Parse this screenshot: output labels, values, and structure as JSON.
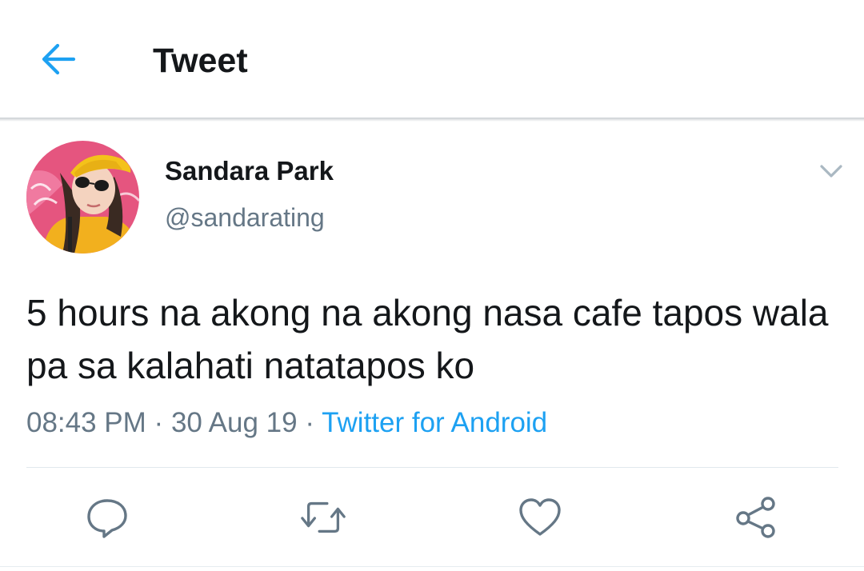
{
  "header": {
    "title": "Tweet",
    "back_icon": "arrow-left-icon",
    "accent_color": "#1da1f2"
  },
  "tweet": {
    "author": {
      "display_name": "Sandara Park",
      "handle": "@sandarating",
      "avatar": "profile-photo"
    },
    "more_icon": "chevron-down-icon",
    "text": "5 hours na akong na akong nasa cafe tapos wala pa sa kalahati natatapos ko",
    "time": "08:43 PM",
    "date": "30 Aug 19",
    "separator": "·",
    "source": "Twitter for Android"
  },
  "actions": [
    {
      "icon": "reply-icon"
    },
    {
      "icon": "retweet-icon"
    },
    {
      "icon": "like-icon"
    },
    {
      "icon": "share-icon"
    }
  ],
  "colors": {
    "text_primary": "#14171a",
    "text_secondary": "#657786",
    "link": "#1da1f2",
    "icon": "#657786"
  }
}
